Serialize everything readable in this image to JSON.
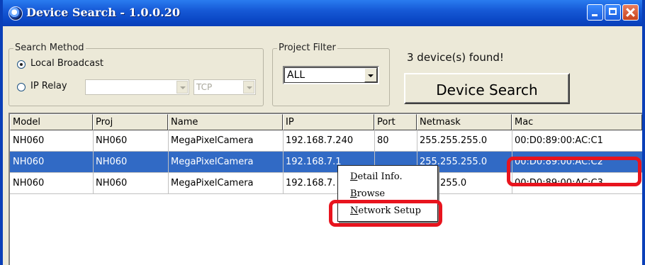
{
  "window": {
    "title": "Device Search - 1.0.0.20"
  },
  "search_method": {
    "legend": "Search Method",
    "local_broadcast_label": "Local Broadcast",
    "ip_relay_label": "IP Relay",
    "ip_relay_value": "",
    "protocol_value": "TCP",
    "selected": "Local Broadcast"
  },
  "project_filter": {
    "legend": "Project Filter",
    "value": "ALL"
  },
  "status_text": "3 device(s) found!",
  "device_search_button": "Device Search",
  "table": {
    "columns": [
      "Model",
      "Proj",
      "Name",
      "IP",
      "Port",
      "Netmask",
      "Mac"
    ],
    "rows": [
      [
        "NH060",
        "NH060",
        "MegaPixelCamera",
        "192.168.7.240",
        "80",
        "255.255.255.0",
        "00:D0:89:00:AC:C1"
      ],
      [
        "NH060",
        "NH060",
        "MegaPixelCamera",
        "192.168.7.1",
        "",
        "255.255.255.0",
        "00:D0:89:00:AC:C2"
      ],
      [
        "NH060",
        "NH060",
        "MegaPixelCamera",
        "192.168.7.",
        "",
        "255.255.0",
        "00:D0:89:00:AC:C3"
      ]
    ],
    "visible_fragments": {
      "row2_ip": "192.168.7.1",
      "row2_netmask": "255.255.255.0",
      "row3_ip": "192.168.7.",
      "row3_netmask": "255.255.0"
    },
    "selected_row": 2
  },
  "context_menu": {
    "items": [
      {
        "label": "Detail Info.",
        "underline": "D",
        "rest": "etail Info."
      },
      {
        "label": "Browse",
        "underline": "B",
        "rest": "rowse"
      },
      {
        "label": "Network Setup",
        "underline": "N",
        "rest": "etwork Setup"
      }
    ]
  },
  "colors": {
    "titlebar": "#0a3fb8",
    "selection": "#316ac5",
    "highlight": "#e8141e",
    "window_bg": "#ece9d8"
  },
  "icons": [
    "app-icon",
    "minimize-icon",
    "maximize-icon",
    "close-icon",
    "dropdown-arrow-icon"
  ]
}
